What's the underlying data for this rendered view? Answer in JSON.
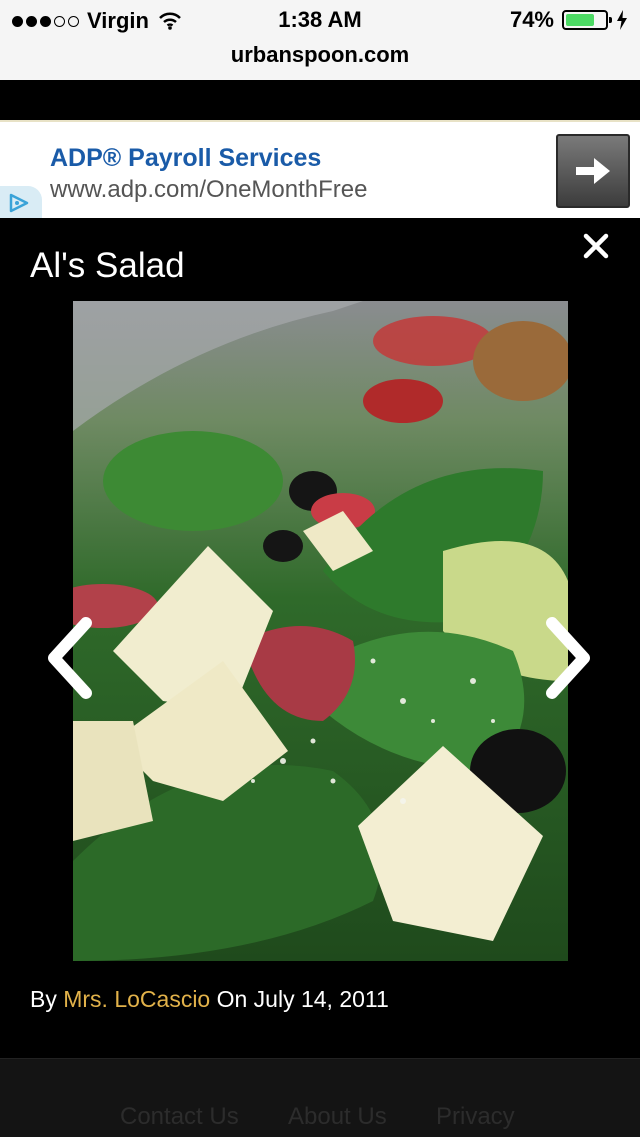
{
  "status_bar": {
    "carrier": "Virgin",
    "time": "1:38 AM",
    "battery_percent": "74%",
    "battery_level": 0.74,
    "signal_bars_filled": 3,
    "signal_bars_total": 5
  },
  "browser": {
    "url": "urbanspoon.com"
  },
  "ad": {
    "title": "ADP® Payroll Services",
    "url": "www.adp.com/OneMonthFree",
    "arrow_icon": "arrow-right-icon",
    "choices_icon": "adchoices-icon"
  },
  "lightbox": {
    "title": "Al's Salad",
    "credit_by": "By",
    "credit_author": "Mrs. LoCascio",
    "credit_on": "On July 14, 2011",
    "close_icon": "close-icon",
    "prev_icon": "chevron-left-icon",
    "next_icon": "chevron-right-icon"
  },
  "footer": {
    "links": [
      "Contact Us",
      "About Us",
      "Privacy"
    ]
  },
  "colors": {
    "author_link": "#e2b24a",
    "ad_title": "#1a5ba8",
    "battery": "#4cd964"
  }
}
